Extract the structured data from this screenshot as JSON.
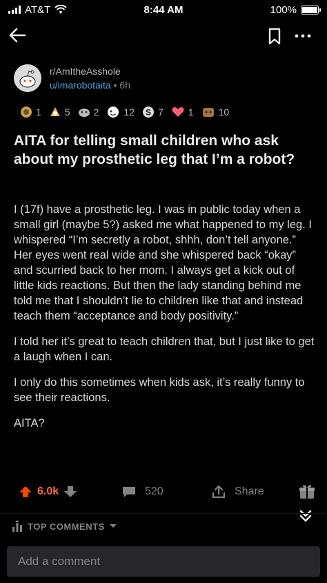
{
  "status_bar": {
    "carrier": "AT&T",
    "time": "8:44 AM",
    "battery": "100%",
    "battery_level": 1.0
  },
  "icons": {
    "back": "back-arrow-icon",
    "bookmark": "bookmark-icon",
    "more": "more-options-icon",
    "upvote": "upvote-arrow-icon",
    "downvote": "downvote-arrow-icon",
    "comments": "comment-bubble-icon",
    "share": "share-icon",
    "gift": "gift-icon",
    "collapse": "double-chevron-down-icon",
    "sort": "sort-icon",
    "dropdown": "caret-down-icon"
  },
  "post": {
    "subreddit": "r/AmItheAsshole",
    "author": "u/imarobotaita",
    "age": "6h",
    "awards": [
      {
        "icon": "award-icon",
        "count": "1"
      },
      {
        "icon": "award-icon",
        "count": "5"
      },
      {
        "icon": "award-icon",
        "count": "2"
      },
      {
        "icon": "award-icon",
        "count": "12"
      },
      {
        "icon": "award-icon",
        "count": "7"
      },
      {
        "icon": "heart-award-icon",
        "count": "1"
      },
      {
        "icon": "award-icon",
        "count": "10"
      }
    ],
    "title": "AITA for telling small children who ask about my prosthetic leg that I’m a robot?",
    "body": [
      "I (17f) have a prosthetic leg. I was in public today when a small girl (maybe 5?) asked me what happened to my leg. I whispered “I’m secretly a robot, shhh, don’t tell anyone.” Her eyes went real wide and she whispered back “okay” and scurried back to her mom. I always get a kick out of little kids reactions. But then the lady standing behind me told me that I shouldn’t lie to children like that and instead teach them “acceptance and body positivity.”",
      "I told her it’s great to teach children that, but I just like to get a laugh when I can.",
      "I only do this sometimes when kids ask, it’s really funny to see their reactions.",
      "AITA?"
    ]
  },
  "actions": {
    "votes": "6.0k",
    "comments": "520",
    "share": "Share"
  },
  "comments_section": {
    "sort_label": "TOP COMMENTS",
    "input_placeholder": "Add a comment"
  },
  "colors": {
    "upvote": "#ff4500",
    "link": "#4fa3e0",
    "background": "#000000",
    "input": "#272729"
  }
}
